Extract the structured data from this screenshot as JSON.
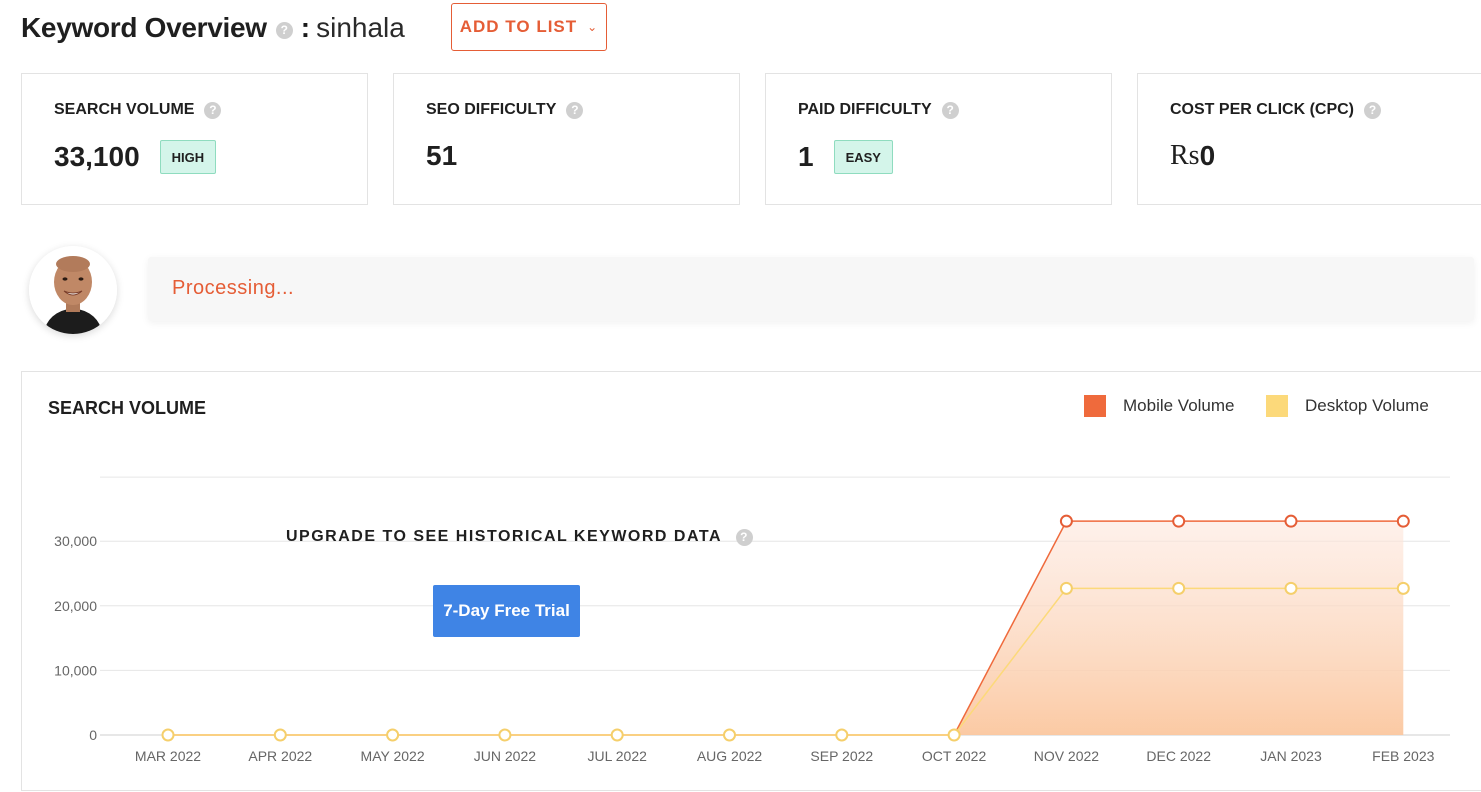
{
  "header": {
    "title": "Keyword Overview",
    "help_icon": "question-icon",
    "separator": ":",
    "keyword": "sinhala",
    "add_to_list_label": "ADD TO LIST"
  },
  "metrics": [
    {
      "label": "SEARCH VOLUME",
      "value": "33,100",
      "badge": "HIGH"
    },
    {
      "label": "SEO DIFFICULTY",
      "value": "51"
    },
    {
      "label": "PAID DIFFICULTY",
      "value": "1",
      "badge": "EASY"
    },
    {
      "label": "COST PER CLICK (CPC)",
      "currency": "Rs",
      "value": "0"
    }
  ],
  "assistant": {
    "status_text": "Processing..."
  },
  "chart_section": {
    "title": "SEARCH VOLUME",
    "upgrade_text": "UPGRADE TO SEE HISTORICAL KEYWORD DATA",
    "trial_button": "7-Day Free Trial"
  },
  "colors": {
    "accent": "#e55d36",
    "mobile": "#ef6a3c",
    "desktop": "#fcd97a",
    "trial_button": "#3f84e5",
    "badge_bg": "#d4f5ea"
  },
  "chart_data": {
    "type": "area",
    "categories": [
      "MAR 2022",
      "APR 2022",
      "MAY 2022",
      "JUN 2022",
      "JUL 2022",
      "AUG 2022",
      "SEP 2022",
      "OCT 2022",
      "NOV 2022",
      "DEC 2022",
      "JAN 2023",
      "FEB 2023"
    ],
    "series": [
      {
        "name": "Mobile Volume",
        "values": [
          0,
          0,
          0,
          0,
          0,
          0,
          0,
          0,
          33100,
          33100,
          33100,
          33100
        ]
      },
      {
        "name": "Desktop Volume",
        "values": [
          0,
          0,
          0,
          0,
          0,
          0,
          0,
          0,
          22700,
          22700,
          22700,
          22700
        ]
      }
    ],
    "yticks": [
      0,
      10000,
      20000,
      30000
    ],
    "ytick_labels": [
      "0",
      "10,000",
      "20,000",
      "30,000"
    ],
    "ylim": [
      0,
      40000
    ],
    "grid": true,
    "legend": "top-right"
  }
}
